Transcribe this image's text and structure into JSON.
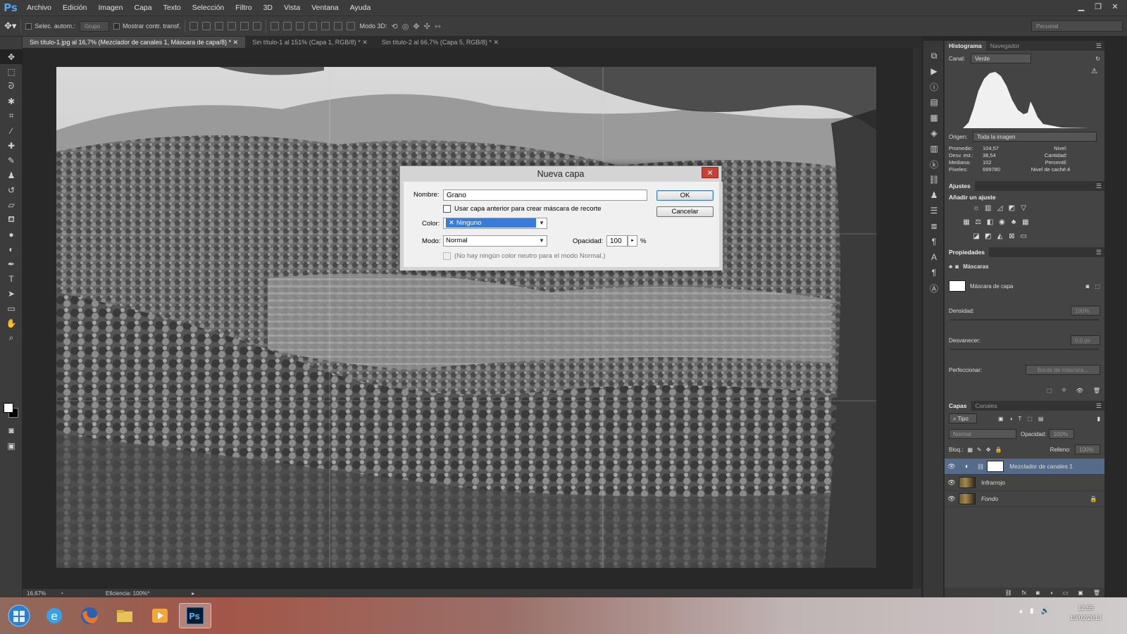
{
  "app": {
    "logo": "Ps"
  },
  "menu": [
    "Archivo",
    "Edición",
    "Imagen",
    "Capa",
    "Texto",
    "Selección",
    "Filtro",
    "3D",
    "Vista",
    "Ventana",
    "Ayuda"
  ],
  "options": {
    "auto_select_label": "Selec. autom.:",
    "group_value": "Grupo",
    "show_transform_label": "Mostrar contr. transf.",
    "mode3d_label": "Modo 3D:",
    "workspace": "Personal"
  },
  "tabs": [
    {
      "label": "Sin título-1.jpg al 16,7% (Mezclador de canales 1, Máscara de capa/8) *",
      "active": true
    },
    {
      "label": "Sin título-1 al 151% (Capa 1, RGB/8) *",
      "active": false
    },
    {
      "label": "Sin título-2 al 66,7% (Capa 5, RGB/8) *",
      "active": false
    }
  ],
  "status": {
    "zoom": "16,67%",
    "efficiency": "Eficiencia: 100%*"
  },
  "histogram": {
    "tabs": [
      "Histograma",
      "Navegador"
    ],
    "channel_label": "Canal:",
    "channel_value": "Verde",
    "source_label": "Origen:",
    "source_value": "Toda la imagen",
    "stats": [
      [
        "Promedio:",
        "104,57",
        "Nivel:",
        ""
      ],
      [
        "Desv. est.:",
        "38,54",
        "Cantidad:",
        ""
      ],
      [
        "Mediana:",
        "102",
        "Percentil:",
        ""
      ],
      [
        "Píxeles:",
        "699780",
        "Nivel de caché:",
        "4"
      ]
    ]
  },
  "adjustments": {
    "tab": "Ajustes",
    "title": "Añadir un ajuste"
  },
  "properties": {
    "tab": "Propiedades",
    "masks_label": "Máscaras",
    "layer_mask_label": "Máscara de capa",
    "density_label": "Densidad:",
    "density_value": "100%",
    "feather_label": "Desvanecer:",
    "feather_value": "0,0 px",
    "refine_label": "Perfeccionar:",
    "mask_edge_button": "Borde de máscara..."
  },
  "layers_panel": {
    "tabs": [
      "Capas",
      "Canales"
    ],
    "filter_kind": "Tipo",
    "blend_mode": "Normal",
    "opacity_label": "Opacidad:",
    "opacity_value": "100%",
    "lock_label": "Bloq.:",
    "fill_label": "Relleno:",
    "fill_value": "100%",
    "layers": [
      {
        "name": "Mezclador de canales 1",
        "active": true
      },
      {
        "name": "Infrarrojo",
        "active": false
      },
      {
        "name": "Fondo",
        "active": false
      }
    ]
  },
  "dialog": {
    "title": "Nueva capa",
    "name_label": "Nombre:",
    "name_value": "Grano",
    "clip_checkbox_label": "Usar capa anterior para crear máscara de recorte",
    "color_label": "Color:",
    "color_value": "Ninguno",
    "mode_label": "Modo:",
    "mode_value": "Normal",
    "opacity_label": "Opacidad:",
    "opacity_value": "100",
    "opacity_unit": "%",
    "neutral_note": "(No hay ningún color neutro para el modo Normal.)",
    "ok_button": "OK",
    "cancel_button": "Cancelar"
  },
  "taskbar": {
    "time": "12:55",
    "date": "19/02/2013"
  }
}
